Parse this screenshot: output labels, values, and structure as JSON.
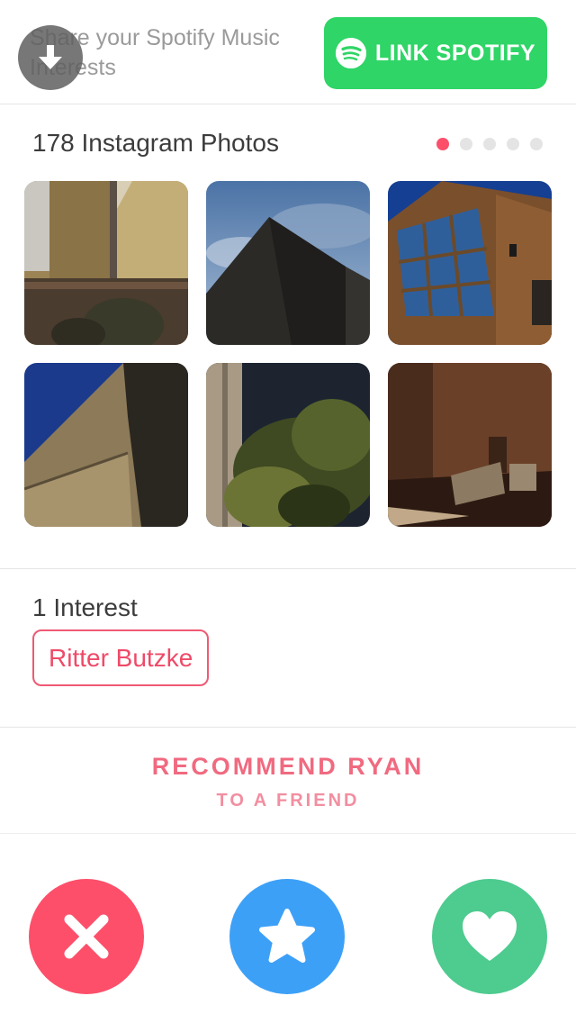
{
  "spotify": {
    "prompt": "Share your Spotify Music Interests",
    "button_label": "LINK SPOTIFY"
  },
  "instagram": {
    "title": "178 Instagram Photos",
    "pager": {
      "pages": 5,
      "current": 1
    },
    "photos": [
      "building wall with drainpipe and shrubs",
      "dark cube building against blue sky",
      "glass window corner building at night",
      "beige building corner at dusk",
      "tree in front of tall building at night",
      "courtyard with benches at night"
    ]
  },
  "interests": {
    "title": "1 Interest",
    "items": [
      "Ritter Butzke"
    ]
  },
  "recommend": {
    "line1": "RECOMMEND RYAN",
    "line2": "TO A FRIEND"
  },
  "actions": {
    "nope_icon": "close-icon",
    "superlike_icon": "star-icon",
    "like_icon": "heart-icon"
  },
  "colors": {
    "spotify_green": "#2fd566",
    "tinder_red": "#fd4f6a",
    "superlike_blue": "#3da0f7",
    "like_green": "#4ecb8f"
  }
}
